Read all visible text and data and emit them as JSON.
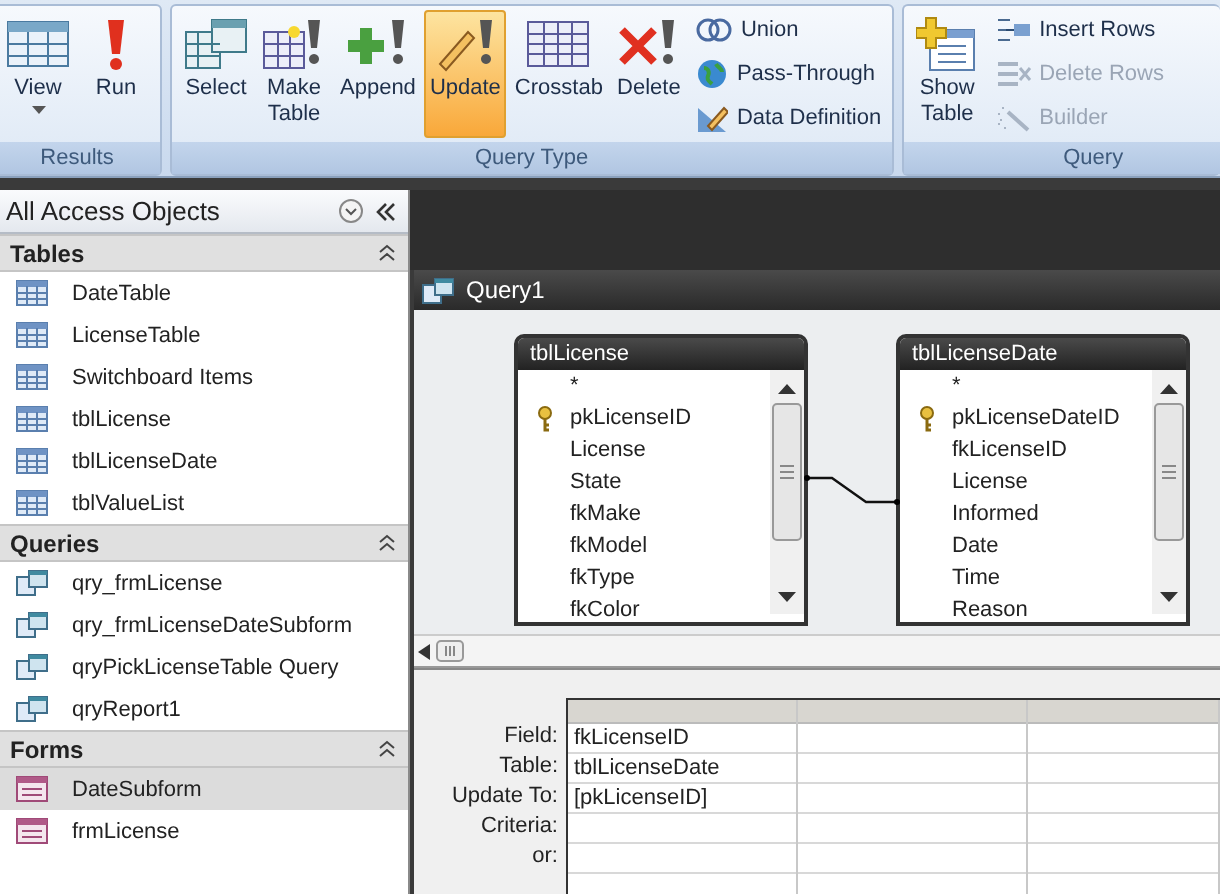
{
  "ribbon": {
    "groups": [
      {
        "label": "Results",
        "large": [
          {
            "label": "View",
            "dropdown": true,
            "selected": false
          },
          {
            "label": "Run",
            "dropdown": false,
            "selected": false
          }
        ]
      },
      {
        "label": "Query Type",
        "large": [
          {
            "label": "Select",
            "selected": false
          },
          {
            "label": "Make Table",
            "selected": false
          },
          {
            "label": "Append",
            "selected": false
          },
          {
            "label": "Update",
            "selected": true
          },
          {
            "label": "Crosstab",
            "selected": false
          },
          {
            "label": "Delete",
            "selected": false
          }
        ],
        "small": [
          {
            "label": "Union",
            "disabled": false
          },
          {
            "label": "Pass-Through",
            "disabled": false
          },
          {
            "label": "Data Definition",
            "disabled": false
          }
        ]
      },
      {
        "label": "Query",
        "large": [
          {
            "label": "Show Table",
            "selected": false
          }
        ],
        "small": [
          {
            "label": "Insert Rows",
            "disabled": false
          },
          {
            "label": "Delete Rows",
            "disabled": true
          },
          {
            "label": "Builder",
            "disabled": true
          }
        ]
      }
    ]
  },
  "navigation": {
    "title": "All Access Objects",
    "sections": [
      {
        "title": "Tables",
        "kind": "table",
        "items": [
          {
            "label": "DateTable",
            "selected": false
          },
          {
            "label": "LicenseTable",
            "selected": false
          },
          {
            "label": "Switchboard Items",
            "selected": false
          },
          {
            "label": "tblLicense",
            "selected": false
          },
          {
            "label": "tblLicenseDate",
            "selected": false
          },
          {
            "label": "tblValueList",
            "selected": false
          }
        ]
      },
      {
        "title": "Queries",
        "kind": "query",
        "items": [
          {
            "label": "qry_frmLicense",
            "selected": false
          },
          {
            "label": "qry_frmLicenseDateSubform",
            "selected": false
          },
          {
            "label": "qryPickLicenseTable Query",
            "selected": false
          },
          {
            "label": "qryReport1",
            "selected": false
          }
        ]
      },
      {
        "title": "Forms",
        "kind": "form",
        "items": [
          {
            "label": "DateSubform",
            "selected": true
          },
          {
            "label": "frmLicense",
            "selected": false
          }
        ]
      }
    ]
  },
  "query_window": {
    "title": "Query1",
    "tables": [
      {
        "title": "tblLicense",
        "fields": [
          {
            "name": "*",
            "key": false
          },
          {
            "name": "pkLicenseID",
            "key": true
          },
          {
            "name": "License",
            "key": false
          },
          {
            "name": "State",
            "key": false
          },
          {
            "name": "fkMake",
            "key": false
          },
          {
            "name": "fkModel",
            "key": false
          },
          {
            "name": "fkType",
            "key": false
          },
          {
            "name": "fkColor",
            "key": false
          }
        ]
      },
      {
        "title": "tblLicenseDate",
        "fields": [
          {
            "name": "*",
            "key": false
          },
          {
            "name": "pkLicenseDateID",
            "key": true
          },
          {
            "name": "fkLicenseID",
            "key": false
          },
          {
            "name": "License",
            "key": false
          },
          {
            "name": "Informed",
            "key": false
          },
          {
            "name": "Date",
            "key": false
          },
          {
            "name": "Time",
            "key": false
          },
          {
            "name": "Reason",
            "key": false
          }
        ]
      }
    ],
    "grid": {
      "row_labels": [
        "Field:",
        "Table:",
        "Update To:",
        "Criteria:",
        "or:"
      ],
      "columns": [
        [
          "fkLicenseID",
          "tblLicenseDate",
          "[pkLicenseID]",
          "",
          ""
        ],
        [
          "",
          "",
          "",
          "",
          ""
        ],
        [
          "",
          "",
          "",
          "",
          ""
        ]
      ]
    }
  }
}
